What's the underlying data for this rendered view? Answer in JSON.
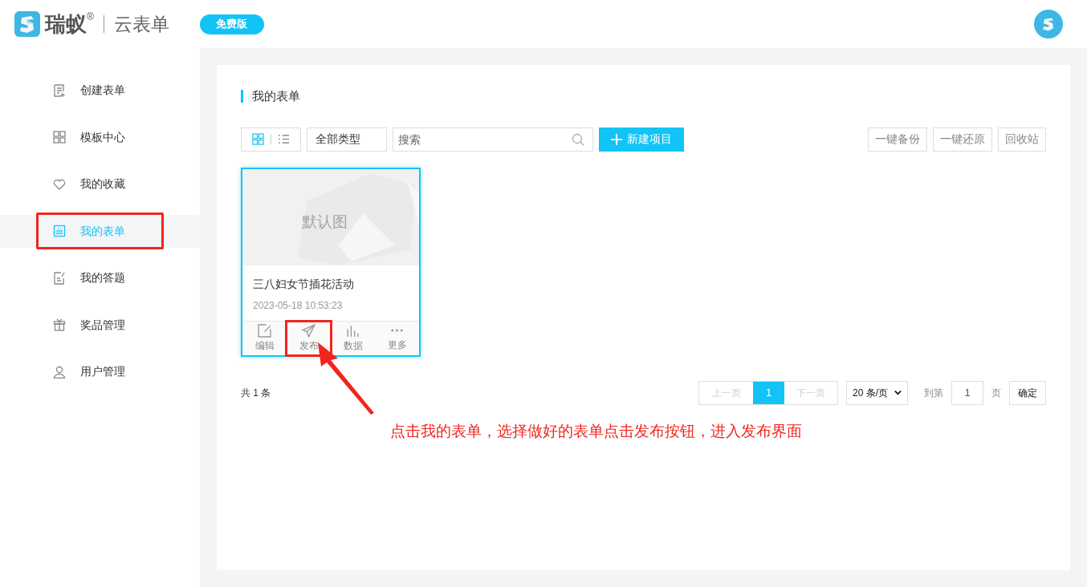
{
  "header": {
    "brand": "瑞蚁",
    "registered": "®",
    "product": "云表单",
    "badge": "免费版"
  },
  "sidebar": {
    "items": [
      {
        "label": "创建表单",
        "selected": false
      },
      {
        "label": "模板中心",
        "selected": false
      },
      {
        "label": "我的收藏",
        "selected": false
      },
      {
        "label": "我的表单",
        "selected": true
      },
      {
        "label": "我的答题",
        "selected": false
      },
      {
        "label": "奖品管理",
        "selected": false
      },
      {
        "label": "用户管理",
        "selected": false
      }
    ]
  },
  "panel": {
    "title": "我的表单",
    "view_toggle": [
      {
        "kind": "grid",
        "selected": true
      },
      {
        "kind": "list",
        "selected": false
      }
    ],
    "type_filter": "全部类型",
    "search": {
      "placeholder": "搜索"
    },
    "new_button": "新建项目",
    "right_buttons": [
      "一键备份",
      "一键还原",
      "回收站"
    ],
    "cards": [
      {
        "cover_text": "默认图",
        "title": "三八妇女节插花活动",
        "date": "2023-05-18 10:53:23",
        "actions": [
          {
            "label": "编辑",
            "highlighted": false
          },
          {
            "label": "发布",
            "highlighted": true
          },
          {
            "label": "数据",
            "highlighted": false
          },
          {
            "label": "更多",
            "highlighted": false
          }
        ]
      }
    ],
    "total": "共 1 条",
    "pagination": {
      "prev": "上一页",
      "pages": [
        {
          "label": "1",
          "selected": true
        }
      ],
      "next": "下一页",
      "page_size": "20 条/页",
      "goto_label": "到第",
      "goto_value": "1",
      "page_unit": "页",
      "confirm": "确定"
    }
  },
  "annotation": {
    "caption": "点击我的表单，选择做好的表单点击发布按钮，进入发布界面"
  }
}
